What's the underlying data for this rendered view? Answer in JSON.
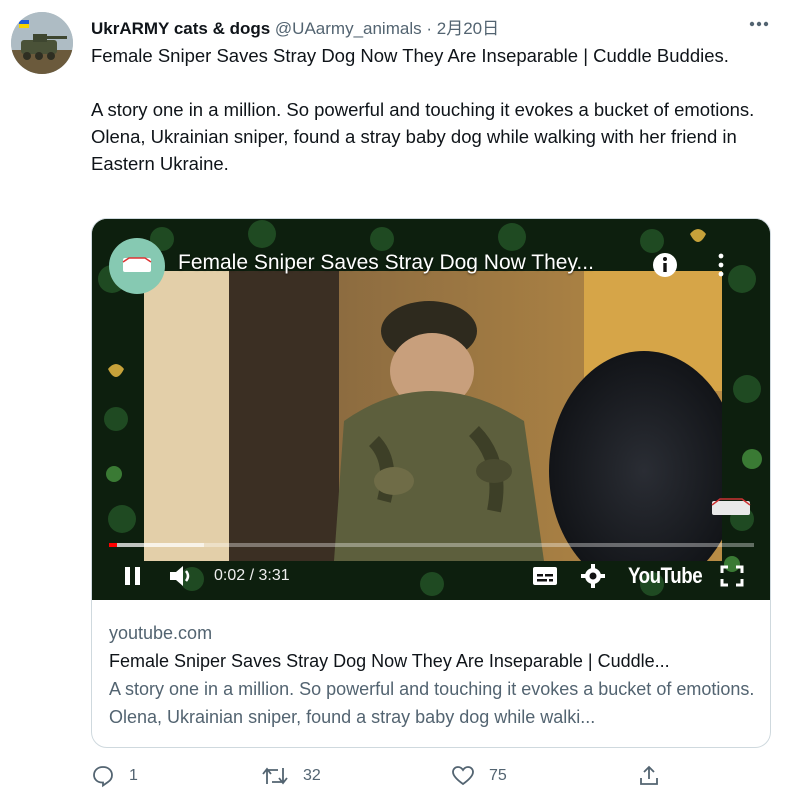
{
  "tweet": {
    "display_name": "UkrARMY cats & dogs",
    "handle": "@UAarmy_animals",
    "separator": "·",
    "date": "2月20日",
    "paragraph1": "Female Sniper Saves Stray Dog Now They Are Inseparable | Cuddle Buddies.",
    "paragraph2": "A story one in a million. So powerful and touching it evokes a bucket of emotions. Olena, Ukrainian sniper, found a stray baby dog while walking with her friend in Eastern Ukraine."
  },
  "video": {
    "title": "Female Sniper Saves Stray Dog Now They...",
    "time": "0:02 / 3:31",
    "brand": "YouTube",
    "progress_played_fraction": 0.012,
    "progress_buffered_fraction": 0.147
  },
  "card": {
    "domain": "youtube.com",
    "title": "Female Sniper Saves Stray Dog Now They Are Inseparable | Cuddle...",
    "description": "A story one in a million. So powerful and touching it evokes a bucket of emotions. Olena, Ukrainian sniper, found a stray baby dog while walki..."
  },
  "actions": {
    "replies": "1",
    "retweets": "32",
    "likes": "75"
  },
  "colors": {
    "secondary_text": "#536471",
    "border": "#cfd9de",
    "progress_red": "#ff0000"
  },
  "icons": [
    "more-icon",
    "info-icon",
    "kebab-icon",
    "pause-icon",
    "volume-icon",
    "subtitles-icon",
    "settings-icon",
    "fullscreen-icon",
    "reply-icon",
    "retweet-icon",
    "like-icon",
    "share-icon"
  ]
}
